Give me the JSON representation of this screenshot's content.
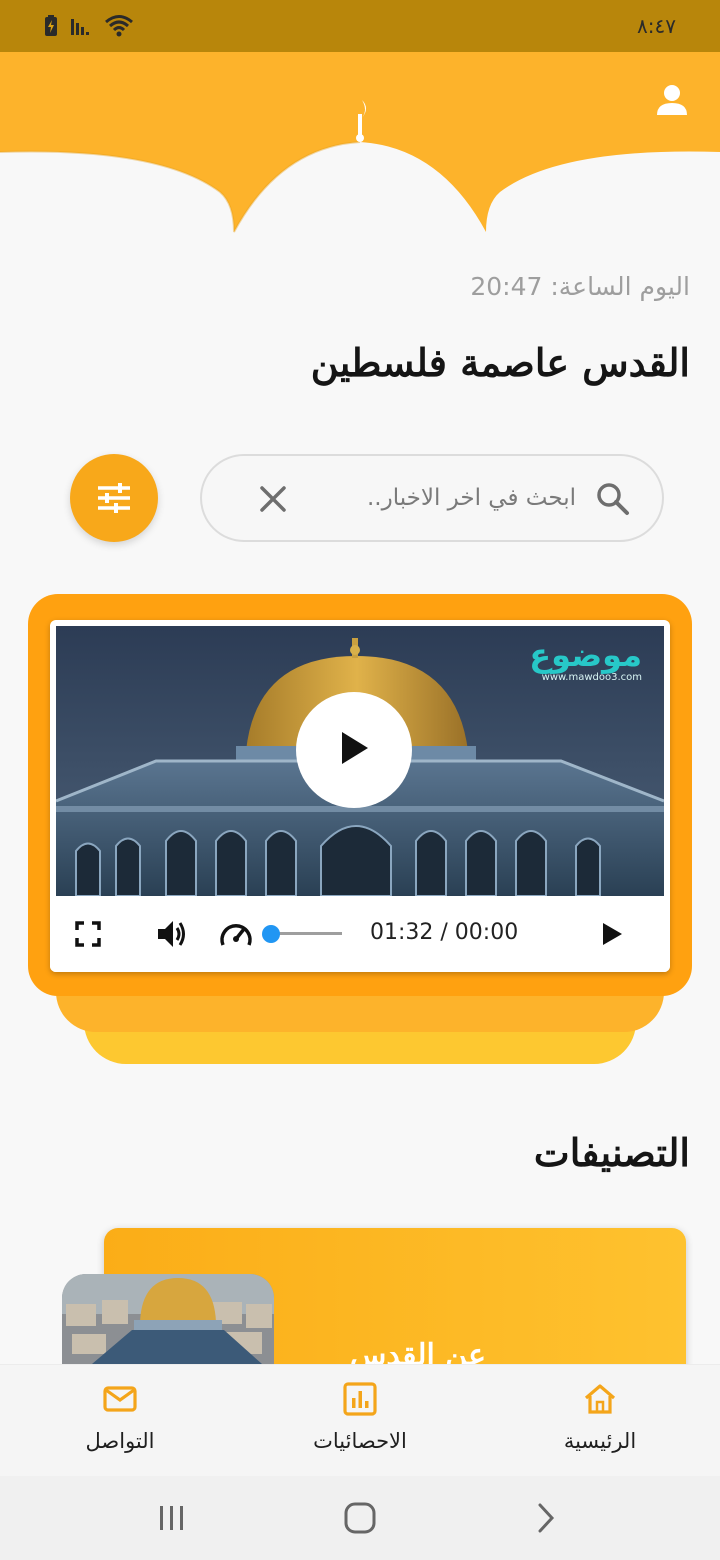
{
  "status_bar": {
    "time": "٨:٤٧",
    "icons": [
      "battery-charging-icon",
      "signal-icon",
      "wifi-icon"
    ]
  },
  "header": {
    "icons": [
      "profile-icon",
      "crescent-icon"
    ],
    "accent_color": "#fdb32b"
  },
  "date_line": "اليوم الساعة: 20:47",
  "page_title": "القدس عاصمة فلسطين",
  "search": {
    "placeholder": "ابحث في اخر الاخبار..",
    "value": "",
    "icons": [
      "search-icon",
      "clear-icon",
      "filter-icon"
    ]
  },
  "video": {
    "logo_name": "موضوع",
    "logo_url": "www.mawdoo3.com",
    "time_display": "01:32 / 00:00",
    "progress": 0,
    "icons": [
      "fullscreen-icon",
      "volume-icon",
      "speed-icon",
      "play-icon"
    ]
  },
  "categories": {
    "title": "التصنيفات",
    "items": [
      {
        "label": "عن القدس"
      }
    ]
  },
  "bottom_nav": {
    "items": [
      {
        "label": "التواصل",
        "icon": "mail-icon"
      },
      {
        "label": "الاحصائيات",
        "icon": "chart-icon"
      },
      {
        "label": "الرئيسية",
        "icon": "home-icon"
      }
    ]
  },
  "system_nav": {
    "icons": [
      "recents-icon",
      "home-circle-icon",
      "back-icon"
    ]
  }
}
